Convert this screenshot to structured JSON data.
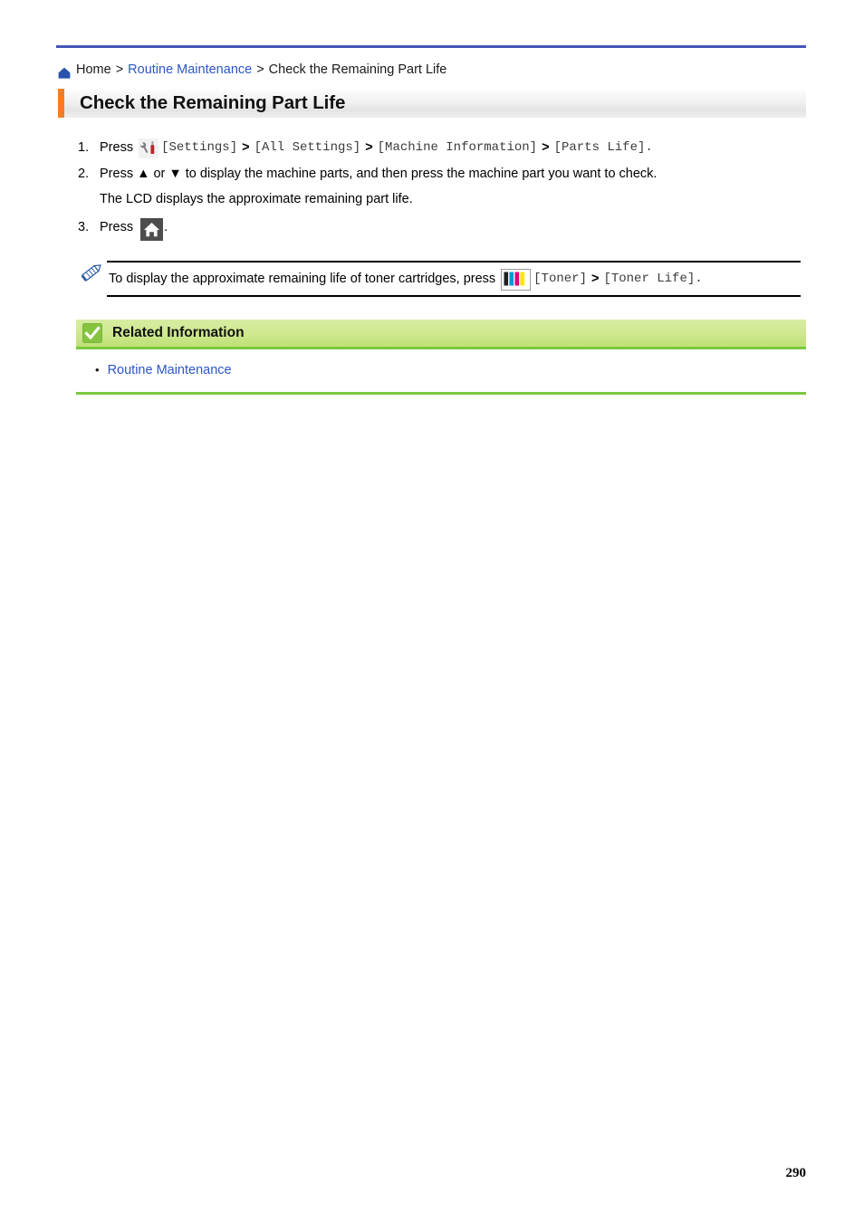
{
  "theme": {
    "top_rule_color": "#4455b4",
    "link_color": "#2b56c6",
    "title_accent_color": "#f57d1f",
    "related_header_green": "#cde88e",
    "related_rule_green": "#79c93c",
    "home_button_bg": "#4d4d4d"
  },
  "breadcrumb": {
    "home_icon": "home-icon",
    "home_label": "Home",
    "sep1": ">",
    "parent_label": "Routine Maintenance",
    "sep2": ">",
    "current_label": "Check the Remaining Part Life"
  },
  "title": {
    "text": "Check the Remaining Part Life"
  },
  "steps": [
    {
      "number": "1.",
      "press_label": "Press",
      "icon": "settings-wrench-screwdriver-icon",
      "tokens": [
        {
          "type": "mono",
          "text": "[Settings]"
        },
        {
          "type": "sep",
          "text": ">"
        },
        {
          "type": "mono",
          "text": "[All Settings]"
        },
        {
          "type": "sep",
          "text": ">"
        },
        {
          "type": "mono",
          "text": "[Machine Information]"
        },
        {
          "type": "sep",
          "text": ">"
        },
        {
          "type": "mono",
          "text": "[Parts Life]."
        }
      ]
    },
    {
      "number": "2.",
      "text": "Press ▲ or ▼ to display the machine parts, and then press the machine part you want to check.",
      "subtext": "The LCD displays the approximate remaining part life."
    },
    {
      "number": "3.",
      "press_label": "Press",
      "icon": "home-button-icon",
      "trailing": "."
    }
  ],
  "note": {
    "icon": "pencil-note-icon",
    "text": "To display the approximate remaining life of toner cartridges, press",
    "toner_icon": "toner-cartridges-icon",
    "toner_colors": [
      "#231f20",
      "#0099d8",
      "#e5007e",
      "#ffe600"
    ],
    "tokens": [
      {
        "type": "mono",
        "text": "[Toner]"
      },
      {
        "type": "sep",
        "text": ">"
      },
      {
        "type": "mono",
        "text": "[Toner Life]."
      }
    ]
  },
  "related": {
    "icon": "green-check-icon",
    "heading": "Related Information",
    "items": [
      {
        "bullet": "•",
        "label": "Routine Maintenance"
      }
    ]
  },
  "footer": {
    "page_number": "290"
  }
}
